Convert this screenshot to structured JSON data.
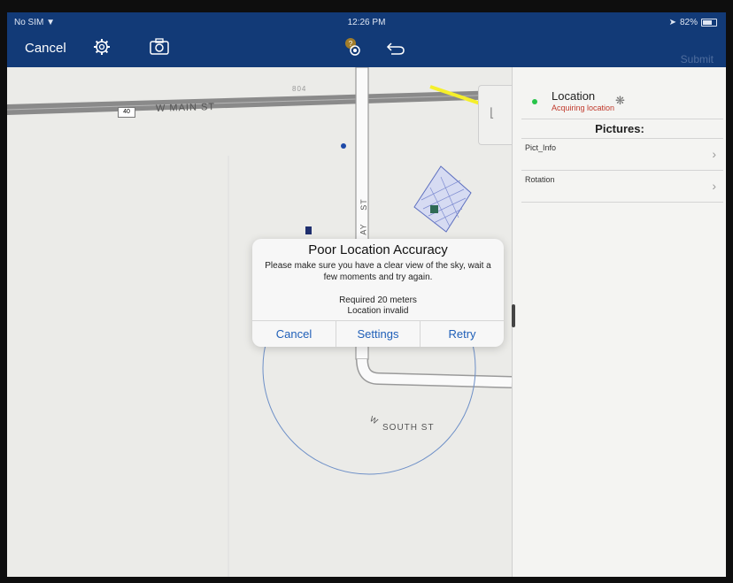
{
  "status": {
    "carrier": "No SIM",
    "time": "12:26 PM",
    "battery": "82%"
  },
  "navbar": {
    "cancel_label": "Cancel",
    "submit_label": "Submit"
  },
  "map": {
    "roads": {
      "main_st": "W MAIN ST",
      "route_shield": "40",
      "south_st": "SOUTH ST",
      "south_prefix": "W",
      "vertical_st": "ST",
      "vertical_prefix": "AY",
      "parcel": "804"
    },
    "accuracy_circle_color": "#6d8fc7"
  },
  "panel": {
    "location_title": "Location",
    "location_status": "Acquiring location",
    "pictures_header": "Pictures:",
    "rows": [
      {
        "label": "Pict_Info"
      },
      {
        "label": "Rotation"
      }
    ]
  },
  "dialog": {
    "title": "Poor Location Accuracy",
    "message": "Please make sure you have a clear view of the sky, wait a few moments and try again.",
    "required": "Required 20 meters",
    "status": "Location invalid",
    "buttons": {
      "cancel": "Cancel",
      "settings": "Settings",
      "retry": "Retry"
    }
  },
  "annotation": {
    "arrow_color": "#f5ef2a"
  },
  "colors": {
    "navbar": "#123a77",
    "link_blue": "#1f5fb8",
    "status_dot": "#27c449",
    "status_text": "#c0392b"
  }
}
